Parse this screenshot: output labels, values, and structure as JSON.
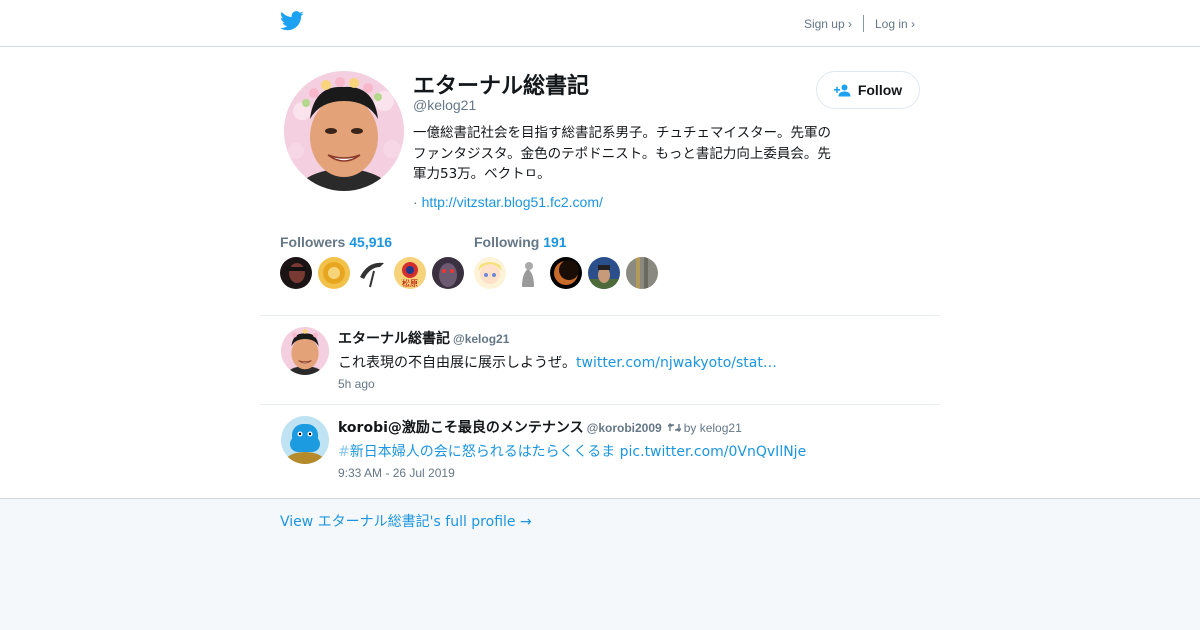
{
  "header": {
    "logo_icon": "twitter-bird-icon",
    "signup_label": "Sign up ›",
    "login_label": "Log in ›"
  },
  "profile": {
    "name": "エターナル総書記",
    "handle": "@kelog21",
    "follow_label": "Follow",
    "bio": "一億総書記社会を目指す総書記系男子。チュチェマイスター。先軍のファンタジスタ。金色のテポドニスト。もっと書記力向上委員会。先軍力53万。ベクトㅁ。",
    "url_prefix": "·",
    "url": "http://vitzstar.blog51.fc2.com/",
    "followers_label": "Followers",
    "followers_count": "45,916",
    "following_label": "Following",
    "following_count": "191",
    "follower_avatar_texts": [
      "松原"
    ]
  },
  "tweets": [
    {
      "name": "エターナル総書記",
      "handle": "@kelog21",
      "retweet_by": "",
      "text": "これ表現の不自由展に展示しようぜ。",
      "link": "twitter.com/njwakyoto/stat…",
      "time": "5h ago"
    },
    {
      "name": "korobi@激励こそ最良のメンテナンス",
      "handle": "@korobi2009",
      "retweet_by": "by kelog21",
      "hash_symbol": "#",
      "hashtag": "新日本婦人の会に怒られるはたらくくるま",
      "link": "pic.twitter.com/0VnQvIlNje",
      "time": "9:33 AM - 26 Jul 2019"
    }
  ],
  "footer": {
    "full_profile_link": "View エターナル総書記's full profile →"
  },
  "colors": {
    "accent": "#1b95e0",
    "bird": "#1da1f2",
    "muted": "#657786"
  }
}
